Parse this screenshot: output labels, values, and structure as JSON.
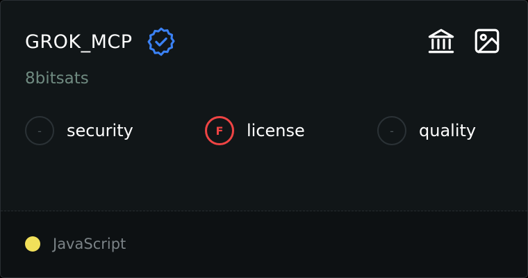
{
  "card": {
    "title": "GROK_MCP",
    "owner": "8bitsats",
    "verified_icon": "verified-badge-icon",
    "actions": [
      {
        "icon": "bank-icon"
      },
      {
        "icon": "image-icon"
      }
    ]
  },
  "scores": [
    {
      "name": "security",
      "grade": "-"
    },
    {
      "name": "license",
      "grade": "F"
    },
    {
      "name": "quality",
      "grade": "-"
    }
  ],
  "footer": {
    "language": "JavaScript",
    "language_color": "#f1e05a"
  },
  "colors": {
    "fail": "#ef4444",
    "verified": "#3b82f6"
  }
}
